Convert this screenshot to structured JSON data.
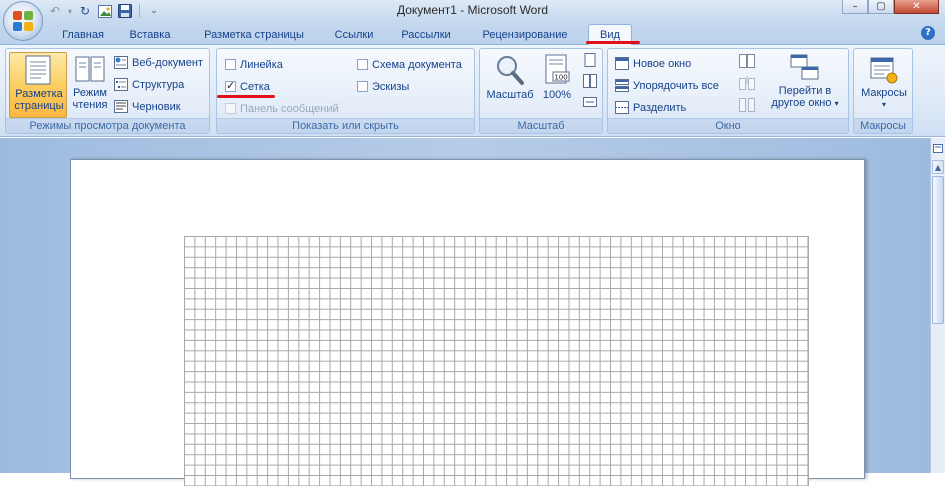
{
  "window": {
    "title": "Документ1 - Microsoft Word",
    "minimize": "–",
    "maximize": "▢",
    "close": "✕"
  },
  "tabs": [
    {
      "label": "Главная"
    },
    {
      "label": "Вставка"
    },
    {
      "label": "Разметка страницы"
    },
    {
      "label": "Ссылки"
    },
    {
      "label": "Рассылки"
    },
    {
      "label": "Рецензирование"
    },
    {
      "label": "Вид",
      "active": true
    }
  ],
  "ribbon": {
    "views": {
      "label": "Режимы просмотра документа",
      "print_layout": "Разметка страницы",
      "reading": "Режим чтения",
      "web": "Веб-документ",
      "outline": "Структура",
      "draft": "Черновик"
    },
    "show_hide": {
      "label": "Показать или скрыть",
      "ruler": {
        "label": "Линейка",
        "checked": false
      },
      "gridlines": {
        "label": "Сетка",
        "checked": true
      },
      "message_bar": {
        "label": "Панель сообщений",
        "checked": false,
        "disabled": true
      },
      "doc_map": {
        "label": "Схема документа",
        "checked": false
      },
      "thumbnails": {
        "label": "Эскизы",
        "checked": false
      }
    },
    "zoom": {
      "label": "Масштаб",
      "zoom_btn": "Масштаб",
      "pct_btn": "100%",
      "pct_icon_text": "100"
    },
    "window": {
      "label": "Окно",
      "new_window": "Новое окно",
      "arrange_all": "Упорядочить все",
      "split": "Разделить",
      "switch_line1": "Перейти в",
      "switch_line2": "другое окно",
      "switch_arrow": "▾"
    },
    "macros": {
      "label": "Макросы",
      "btn": "Макросы",
      "arrow": "▾"
    }
  },
  "help": "?",
  "colors": {
    "annotation_red": "#e2101a",
    "ribbon_text": "#15428b",
    "selected_button": "#fbcf62"
  }
}
